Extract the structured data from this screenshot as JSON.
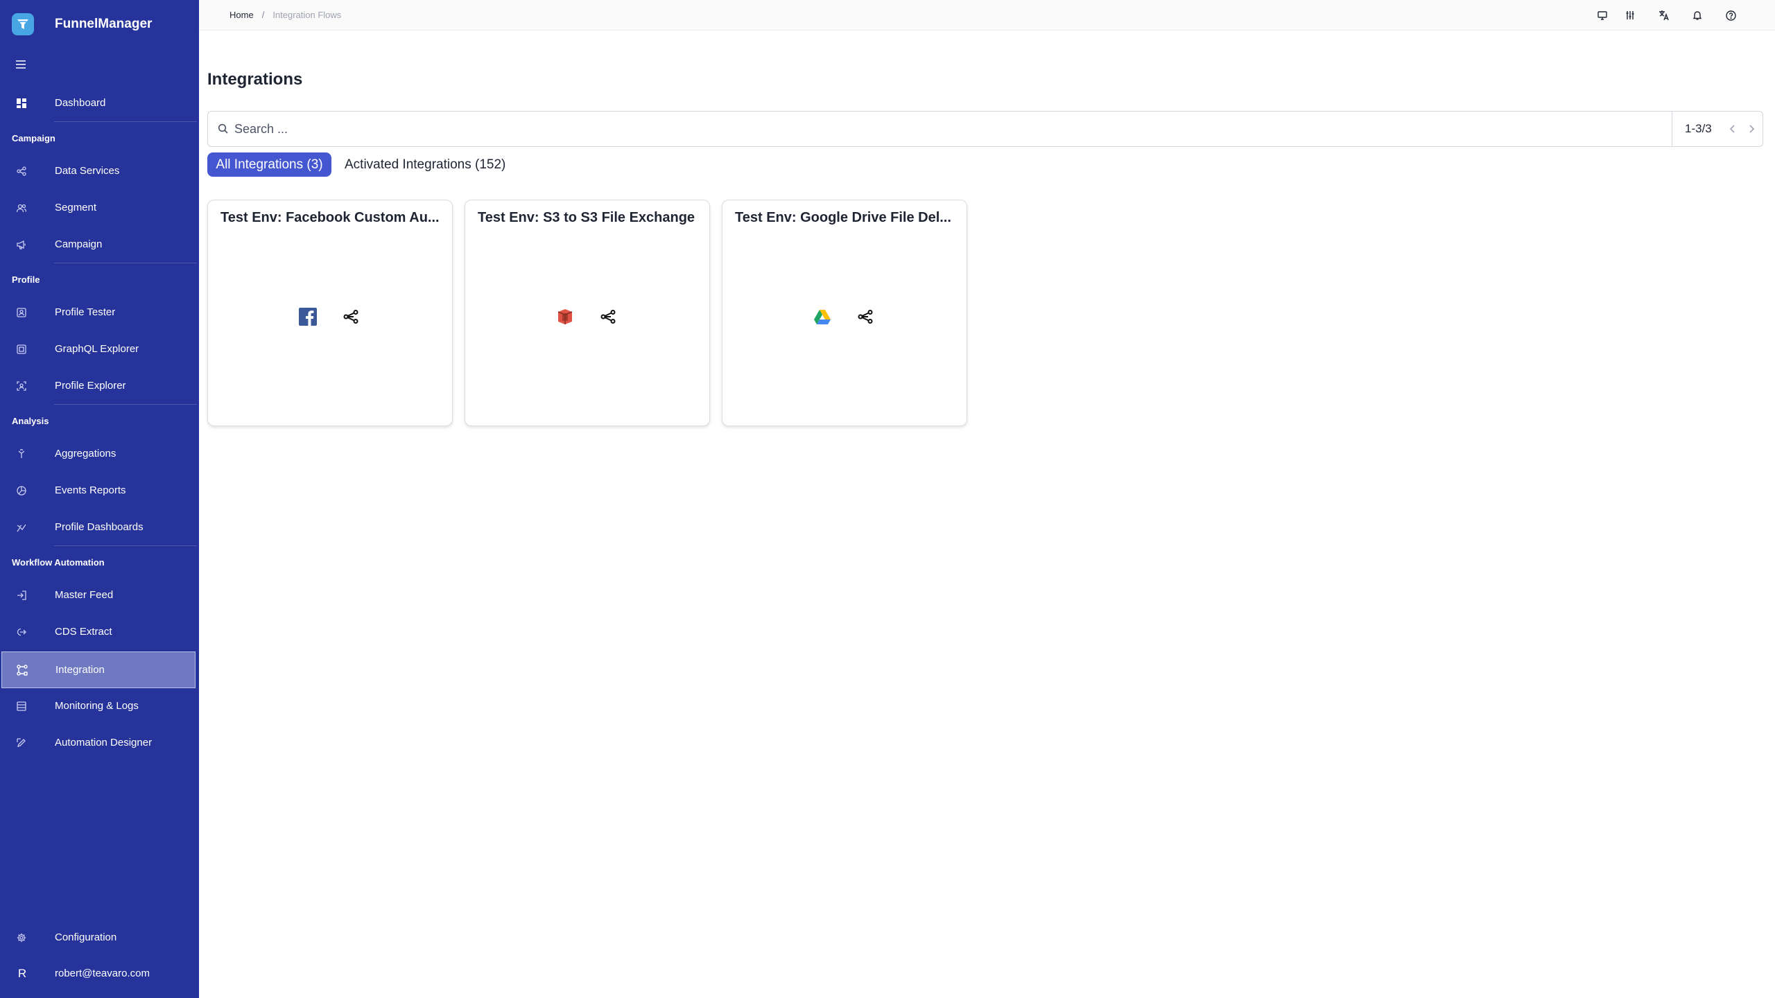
{
  "app": {
    "name": "FunnelManager"
  },
  "breadcrumb": {
    "home": "Home",
    "separator": "/",
    "current": "Integration Flows"
  },
  "sidebar": {
    "dashboard": "Dashboard",
    "sections": [
      {
        "title": "Campaign",
        "items": [
          "Data Services",
          "Segment",
          "Campaign"
        ]
      },
      {
        "title": "Profile",
        "items": [
          "Profile Tester",
          "GraphQL Explorer",
          "Profile Explorer"
        ]
      },
      {
        "title": "Analysis",
        "items": [
          "Aggregations",
          "Events Reports",
          "Profile Dashboards"
        ]
      },
      {
        "title": "Workflow Automation",
        "items": [
          "Master Feed",
          "CDS Extract",
          "Integration",
          "Monitoring & Logs",
          "Automation Designer"
        ]
      }
    ],
    "active_item": "Integration",
    "configuration": "Configuration",
    "user": {
      "initial": "R",
      "email": "robert@teavaro.com"
    }
  },
  "topbar_icons": [
    "monitor-icon",
    "sliders-icon",
    "translate-icon",
    "bell-icon",
    "help-circle-icon"
  ],
  "main": {
    "title": "Integrations",
    "search": {
      "placeholder": "Search ...",
      "value": ""
    },
    "pagination": "1-3/3",
    "tabs": {
      "all": "All Integrations (3)",
      "activated": "Activated Integrations (152)",
      "selected": "all"
    },
    "cards": [
      {
        "title": "Test Env: Facebook Custom Au...",
        "icon": "facebook-icon"
      },
      {
        "title": "Test Env: S3 to S3 File Exchange",
        "icon": "aws-s3-icon"
      },
      {
        "title": "Test Env: Google Drive File Del...",
        "icon": "google-drive-icon"
      }
    ]
  },
  "colors": {
    "sidebar": "#26339a",
    "active_item": "#6e79c2",
    "tab_selected": "#4457d1",
    "brand_logo": "#49a6e4"
  }
}
